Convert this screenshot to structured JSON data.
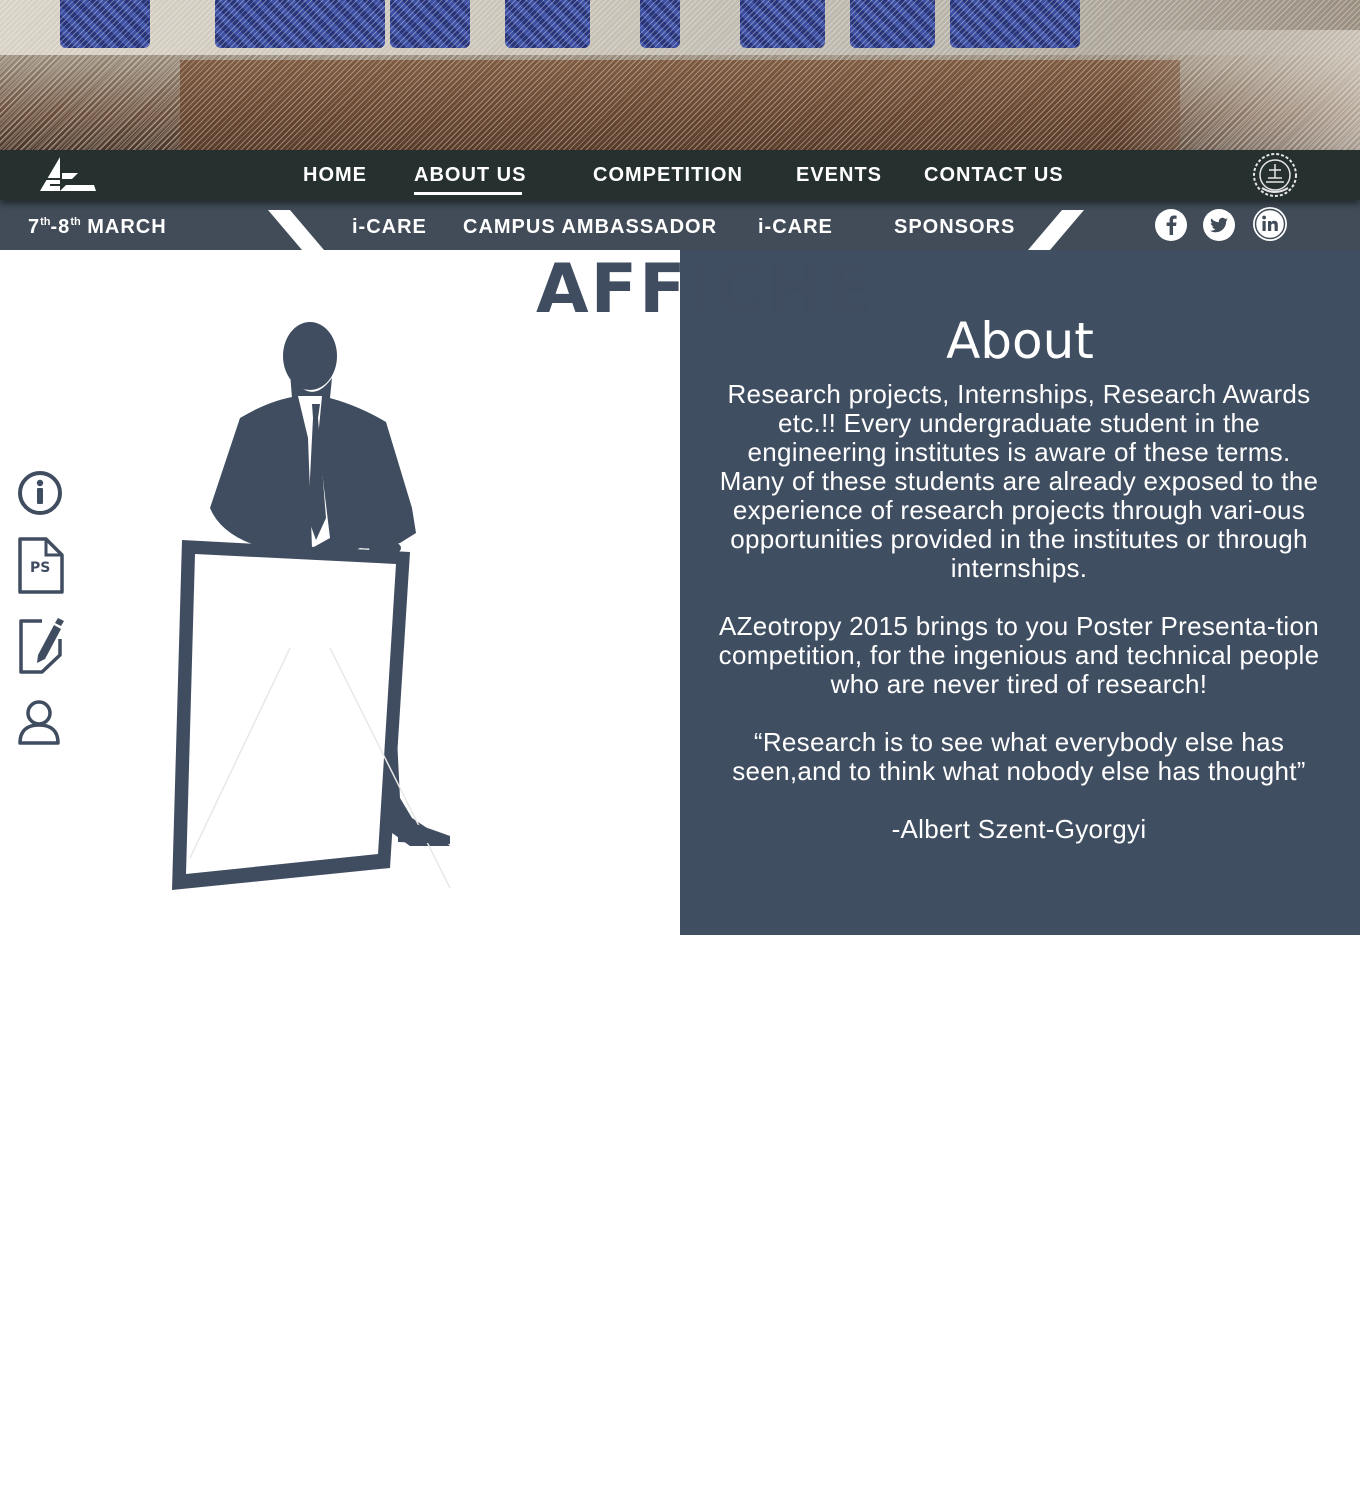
{
  "nav": {
    "items": [
      {
        "label": "HOME"
      },
      {
        "label": "ABOUT US",
        "active": true
      },
      {
        "label": "COMPETITION"
      },
      {
        "label": "EVENTS"
      },
      {
        "label": "CONTACT US"
      }
    ]
  },
  "subnav": {
    "date_day1": "7",
    "date_sup1": "th",
    "date_sep": "-8",
    "date_sup2": "th",
    "date_month": " MARCH",
    "items": [
      {
        "label": "i-CARE"
      },
      {
        "label": "CAMPUS AMBASSADOR"
      },
      {
        "label": "i-CARE"
      },
      {
        "label": "SPONSORS"
      }
    ],
    "social": [
      "facebook-icon",
      "twitter-icon",
      "linkedin-icon"
    ]
  },
  "side_icons": [
    "info-icon",
    "ps-document-icon",
    "edit-document-icon",
    "user-icon"
  ],
  "side_icon_ps_text": "PS",
  "main": {
    "title": "AFFICHE",
    "about": {
      "heading": "About",
      "paragraphs": [
        "Research projects, Internships, Research Awards etc.!! Every undergraduate student in the engineering institutes is aware of these terms. Many of these students are already exposed to the experience of research projects through vari-ous opportunities provided in the institutes or through internships.",
        "AZeotropy 2015 brings to you Poster Presenta-tion competition, for the ingenious and technical people who are never tired of research!",
        "“Research is to see what everybody else has seen,and to think what nobody else has thought”",
        "-Albert Szent-Gyorgyi"
      ]
    }
  },
  "colors": {
    "nav_bg": "#26302f",
    "subnav_bg": "#414c58",
    "panel_bg": "#404e62",
    "accent_text": "#404d60"
  }
}
